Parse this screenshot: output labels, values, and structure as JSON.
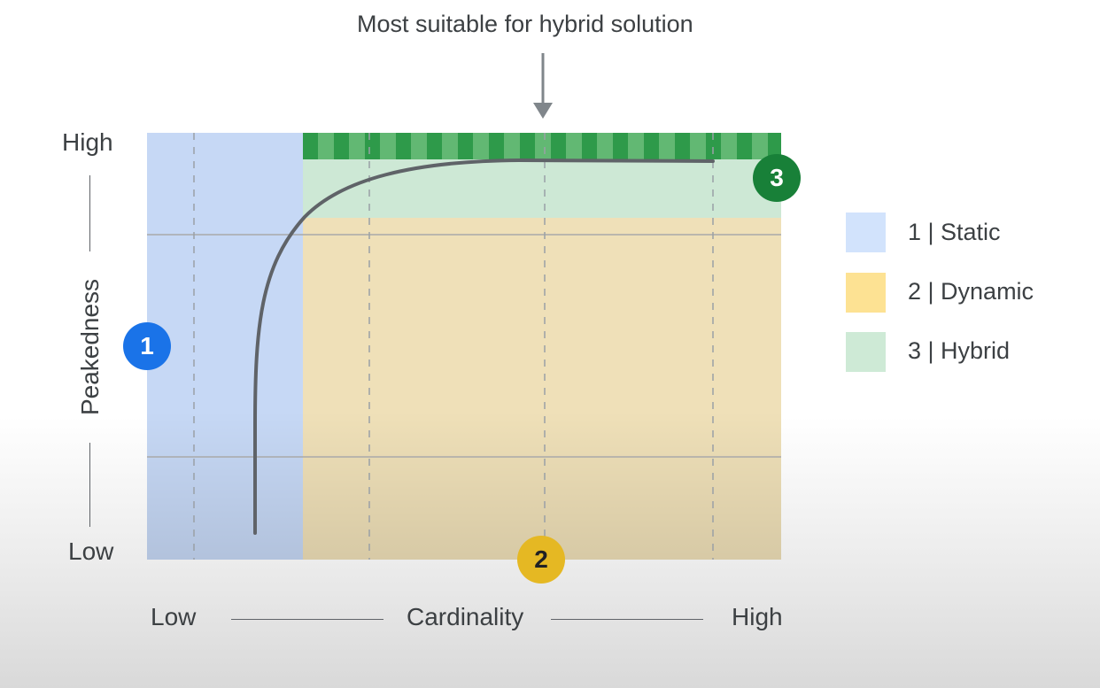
{
  "annotation": {
    "text": "Most suitable for hybrid solution"
  },
  "y_axis": {
    "label": "Peakedness",
    "high": "High",
    "low": "Low"
  },
  "x_axis": {
    "label": "Cardinality",
    "low": "Low",
    "high": "High"
  },
  "zones": [
    {
      "id": "1",
      "name": "Static",
      "legend": "1 | Static",
      "color": "#c6d8f5",
      "badge_color": "#1a73e8",
      "badge_text_color": "#ffffff"
    },
    {
      "id": "2",
      "name": "Dynamic",
      "legend": "2 | Dynamic",
      "color": "#efe0b8",
      "badge_color": "#e5b823",
      "badge_text_color": "#202124"
    },
    {
      "id": "3",
      "name": "Hybrid",
      "legend": "3 | Hybrid",
      "color": "#cde8d5",
      "badge_color": "#188038",
      "badge_text_color": "#ffffff"
    }
  ],
  "colors": {
    "hybrid_band_dark": "#2e9a4a",
    "hybrid_band_light": "#62b873",
    "curve": "#5f6368",
    "gridline": "#a9a9a9",
    "arrow": "#80868b"
  }
}
